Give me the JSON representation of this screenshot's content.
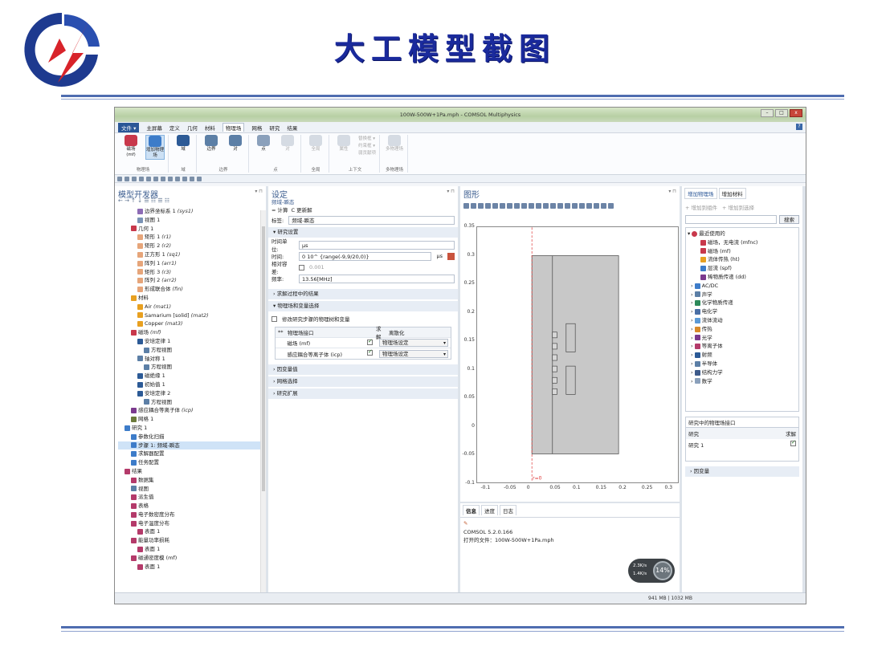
{
  "slide": {
    "title": "大工模型截图",
    "colors": {
      "title": "#1a2a9c",
      "rule": "#4f6db0"
    }
  },
  "window": {
    "title": "100W-500W+1Pa.mph - COMSOL Multiphysics",
    "buttons": [
      "–",
      "□",
      "x"
    ]
  },
  "menu": {
    "file": "文件 ▾",
    "items": [
      "主屏幕",
      "定义",
      "几何",
      "材料",
      "物理场",
      "网格",
      "研究",
      "结果"
    ],
    "active_index": 4,
    "help": "?"
  },
  "ribbon": {
    "groups": [
      {
        "label": "物理场",
        "items": [
          {
            "label": "磁场 (mf)",
            "icon": "magnet-icon"
          },
          {
            "label": "增加物理场",
            "icon": "add-physics-icon",
            "selected": true
          }
        ]
      },
      {
        "label": "域",
        "items": [
          {
            "label": "域",
            "icon": "domain-icon"
          }
        ]
      },
      {
        "label": "边界",
        "items": [
          {
            "label": "边界",
            "icon": "boundary-icon"
          },
          {
            "label": "对",
            "icon": "pair-icon"
          }
        ]
      },
      {
        "label": "点",
        "items": [
          {
            "label": "点",
            "icon": "point-icon"
          },
          {
            "label": "对",
            "icon": "point-pair-icon",
            "disabled": true
          }
        ]
      },
      {
        "label": "全局",
        "items": [
          {
            "label": "全局",
            "icon": "global-icon",
            "disabled": true
          }
        ]
      },
      {
        "label": "上下文",
        "items": [
          {
            "label": "属性",
            "icon": "property-icon",
            "disabled": true
          }
        ]
      },
      {
        "label": "多物理场",
        "items": [
          {
            "label": "多物理场",
            "icon": "multiphysics-icon",
            "disabled": true
          }
        ]
      }
    ],
    "context_small": [
      "替换框 ▾",
      "约束框 ▾",
      "弱贡献项"
    ]
  },
  "model_builder": {
    "title": "模型开发器",
    "nodes": [
      {
        "indent": 3,
        "label": "边界坐标系 1",
        "tag": "(sys1)",
        "color": "#8d6bb5"
      },
      {
        "indent": 3,
        "label": "视图 1",
        "tag": "",
        "color": "#7a93b5"
      },
      {
        "indent": 2,
        "label": "几何 1",
        "tag": "",
        "color": "#c8384b"
      },
      {
        "indent": 3,
        "label": "矩形 1",
        "tag": "(r1)",
        "color": "#e6a57a"
      },
      {
        "indent": 3,
        "label": "矩形 2",
        "tag": "(r2)",
        "color": "#e6a57a"
      },
      {
        "indent": 3,
        "label": "正方形 1",
        "tag": "(sq1)",
        "color": "#e6a57a"
      },
      {
        "indent": 3,
        "label": "阵列 1",
        "tag": "(arr1)",
        "color": "#e6a57a"
      },
      {
        "indent": 3,
        "label": "矩形 3",
        "tag": "(r3)",
        "color": "#e6a57a"
      },
      {
        "indent": 3,
        "label": "阵列 2",
        "tag": "(arr2)",
        "color": "#e6a57a"
      },
      {
        "indent": 3,
        "label": "形成联合体",
        "tag": "(fin)",
        "color": "#e6a57a"
      },
      {
        "indent": 2,
        "label": "材料",
        "tag": "",
        "color": "#e8a020"
      },
      {
        "indent": 3,
        "label": "Air",
        "tag": "(mat1)",
        "color": "#e8a020"
      },
      {
        "indent": 3,
        "label": "Samarium [solid]",
        "tag": "(mat2)",
        "color": "#e8a020"
      },
      {
        "indent": 3,
        "label": "Copper",
        "tag": "(mat3)",
        "color": "#e8a020"
      },
      {
        "indent": 2,
        "label": "磁场",
        "tag": "(mf)",
        "color": "#c8384b"
      },
      {
        "indent": 3,
        "label": "安培定律 1",
        "tag": "",
        "color": "#2c5a96"
      },
      {
        "indent": 4,
        "label": "方程视图",
        "tag": "",
        "color": "#5c7fa6"
      },
      {
        "indent": 3,
        "label": "轴对称 1",
        "tag": "",
        "color": "#5c7fa6"
      },
      {
        "indent": 4,
        "label": "方程视图",
        "tag": "",
        "color": "#5c7fa6"
      },
      {
        "indent": 3,
        "label": "磁绝缘 1",
        "tag": "",
        "color": "#2c5a96"
      },
      {
        "indent": 3,
        "label": "初始值 1",
        "tag": "",
        "color": "#2c5a96"
      },
      {
        "indent": 3,
        "label": "安培定律 2",
        "tag": "",
        "color": "#2c5a96"
      },
      {
        "indent": 4,
        "label": "方程视图",
        "tag": "",
        "color": "#5c7fa6"
      },
      {
        "indent": 2,
        "label": "感应耦合等离子体",
        "tag": "(icp)",
        "color": "#7b3a8e"
      },
      {
        "indent": 2,
        "label": "网格 1",
        "tag": "",
        "color": "#6b7a3b"
      },
      {
        "indent": 1,
        "label": "研究 1",
        "tag": "",
        "color": "#3d7cc9"
      },
      {
        "indent": 2,
        "label": "参数化扫描",
        "tag": "",
        "color": "#3d7cc9"
      },
      {
        "indent": 2,
        "label": "步骤 1: 频域-瞬态",
        "tag": "",
        "color": "#3d7cc9",
        "selected": true
      },
      {
        "indent": 2,
        "label": "求解器配置",
        "tag": "",
        "color": "#3d7cc9"
      },
      {
        "indent": 2,
        "label": "任务配置",
        "tag": "",
        "color": "#3d7cc9"
      },
      {
        "indent": 1,
        "label": "结果",
        "tag": "",
        "color": "#b43a6a"
      },
      {
        "indent": 2,
        "label": "数据集",
        "tag": "",
        "color": "#b43a6a"
      },
      {
        "indent": 2,
        "label": "视图",
        "tag": "",
        "color": "#5c7fa6"
      },
      {
        "indent": 2,
        "label": "派生值",
        "tag": "",
        "color": "#b43a6a"
      },
      {
        "indent": 2,
        "label": "表格",
        "tag": "",
        "color": "#b43a6a"
      },
      {
        "indent": 2,
        "label": "电子数密度分布",
        "tag": "",
        "color": "#b43a6a"
      },
      {
        "indent": 2,
        "label": "电子温度分布",
        "tag": "",
        "color": "#b43a6a"
      },
      {
        "indent": 3,
        "label": "表面 1",
        "tag": "",
        "color": "#b43a6a"
      },
      {
        "indent": 2,
        "label": "能量功率损耗",
        "tag": "",
        "color": "#b43a6a"
      },
      {
        "indent": 3,
        "label": "表面 1",
        "tag": "",
        "color": "#b43a6a"
      },
      {
        "indent": 2,
        "label": "磁通密度模 (mf)",
        "tag": "",
        "color": "#b43a6a"
      },
      {
        "indent": 3,
        "label": "表面 1",
        "tag": "",
        "color": "#b43a6a"
      }
    ]
  },
  "settings": {
    "title": "设定",
    "subtitle": "频域-瞬态",
    "compute": "= 计算",
    "update": "C 更新解",
    "label_caption": "标签:",
    "label_value": "频域-瞬态",
    "study_settings": "研究设置",
    "time_unit_caption": "时间单位:",
    "time_unit_value": "μs",
    "times_caption": "时间:",
    "times_value": "0 10^ {range(-9,9/20,0)}",
    "times_unit": "μs",
    "tolerance_caption": "相对容差:",
    "tolerance_value": "0.001",
    "frequency_caption": "频率:",
    "frequency_value": "13.56[MHz]",
    "sections_collapsed": [
      "求解过程中的结果"
    ],
    "physics_section": "物理场和变量选择",
    "modify_checkbox": "修改研究步骤的物理树和变量",
    "table_head": [
      "**",
      "物理场接口",
      "求解",
      "离散化"
    ],
    "table_rows": [
      {
        "interface": "磁场 (mf)",
        "discretization": "物理场设定"
      },
      {
        "interface": "感应耦合等离子体 (icp)",
        "discretization": "物理场设定"
      }
    ],
    "more_sections": [
      "因变量值",
      "网格选择",
      "研究扩展"
    ]
  },
  "graphics": {
    "title": "图形",
    "axis_hint": "r=0",
    "x_ticks": [
      "-0.1",
      "-0.05",
      "0",
      "0.05",
      "0.1",
      "0.15",
      "0.2",
      "0.25",
      "0.3"
    ],
    "y_ticks": [
      "0.35",
      "0.3",
      "0.25",
      "0.2",
      "0.15",
      "0.1",
      "0.05",
      "0",
      "-0.05",
      "-0.1"
    ],
    "xlim": [
      -0.12,
      0.32
    ],
    "ylim": [
      -0.1,
      0.35
    ]
  },
  "messages": {
    "tabs": [
      "信息",
      "进度",
      "日志"
    ],
    "version": "COMSOL 5.2.0.166",
    "opened": "打开的文件：100W-500W+1Pa.mph",
    "net_up": "2.3K/s",
    "net_down": "1.4K/s",
    "percent": "14%"
  },
  "add_physics": {
    "tabs": [
      "增加物理场",
      "增加材料"
    ],
    "add_component": "+ 增加到组件",
    "add_selection": "+ 增加到选择",
    "search_button": "搜索",
    "recent": "最近使用的",
    "recent_items": [
      "磁场，无电流 (mfnc)",
      "磁场 (mf)",
      "流体传热 (ht)",
      "层流 (spf)",
      "稀物质传递 (dd)"
    ],
    "categories": [
      "AC/DC",
      "声学",
      "化学物质传递",
      "电化学",
      "流体流动",
      "传热",
      "光学",
      "等离子体",
      "射频",
      "半导体",
      "结构力学",
      "数学"
    ],
    "interfaces_title": "研究中的物理场接口",
    "study_col": "研究",
    "solve_col": "求解",
    "study_row": "研究 1",
    "dependent": "因变量"
  },
  "status": {
    "memory": "941 MB | 1032 MB"
  }
}
